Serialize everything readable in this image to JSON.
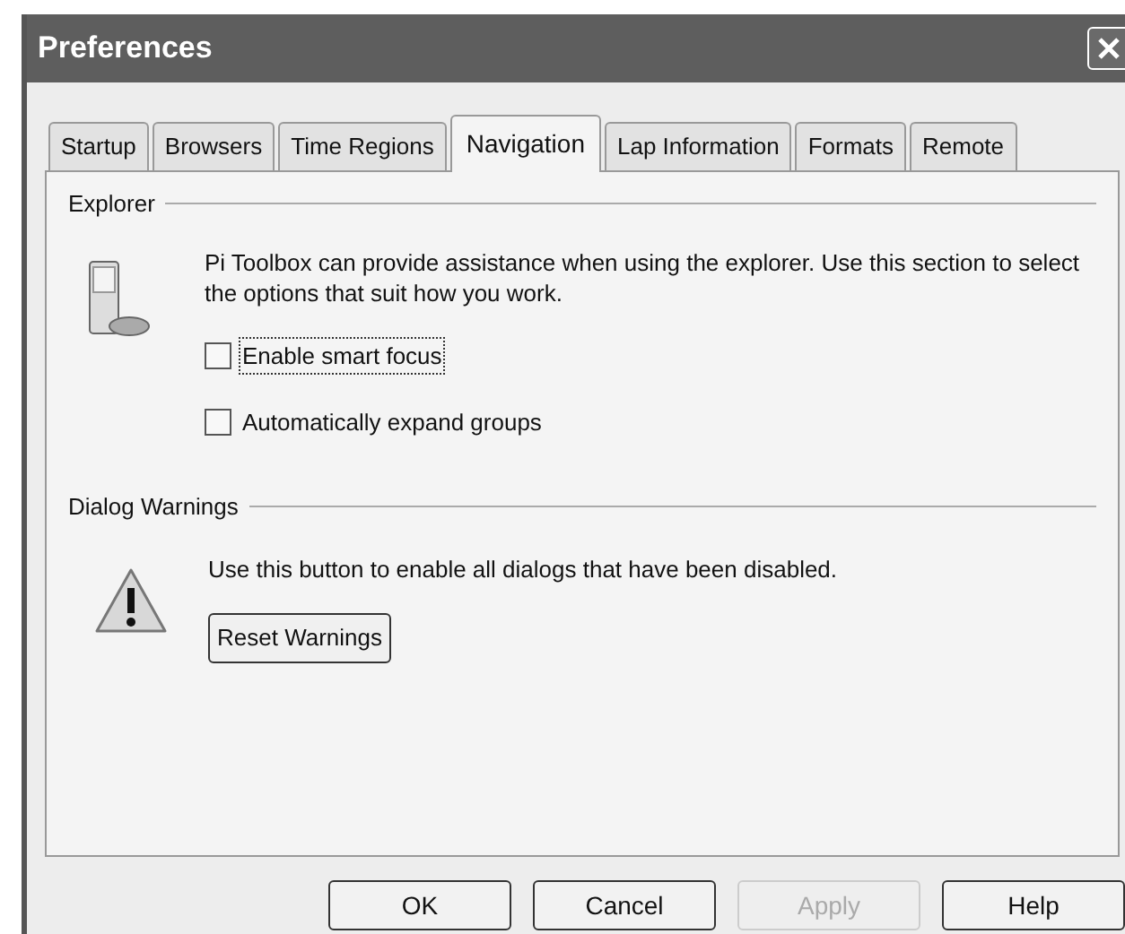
{
  "window": {
    "title": "Preferences"
  },
  "tabs": [
    {
      "label": "Startup",
      "selected": false
    },
    {
      "label": "Browsers",
      "selected": false
    },
    {
      "label": "Time Regions",
      "selected": false
    },
    {
      "label": "Navigation",
      "selected": true
    },
    {
      "label": "Lap Information",
      "selected": false
    },
    {
      "label": "Formats",
      "selected": false
    },
    {
      "label": "Remote",
      "selected": false
    }
  ],
  "explorer": {
    "heading": "Explorer",
    "description": "Pi Toolbox can provide assistance when using the explorer.  Use this section to select the options that suit how you work.",
    "options": [
      {
        "label": "Enable smart focus",
        "checked": false,
        "focused": true
      },
      {
        "label": "Automatically expand groups",
        "checked": false,
        "focused": false
      }
    ]
  },
  "dialog_warnings": {
    "heading": "Dialog Warnings",
    "description": "Use this button to enable all dialogs that have been disabled.",
    "button": "Reset Warnings"
  },
  "buttons": [
    {
      "label": "OK",
      "disabled": false
    },
    {
      "label": "Cancel",
      "disabled": false
    },
    {
      "label": "Apply",
      "disabled": true
    },
    {
      "label": "Help",
      "disabled": false
    }
  ]
}
